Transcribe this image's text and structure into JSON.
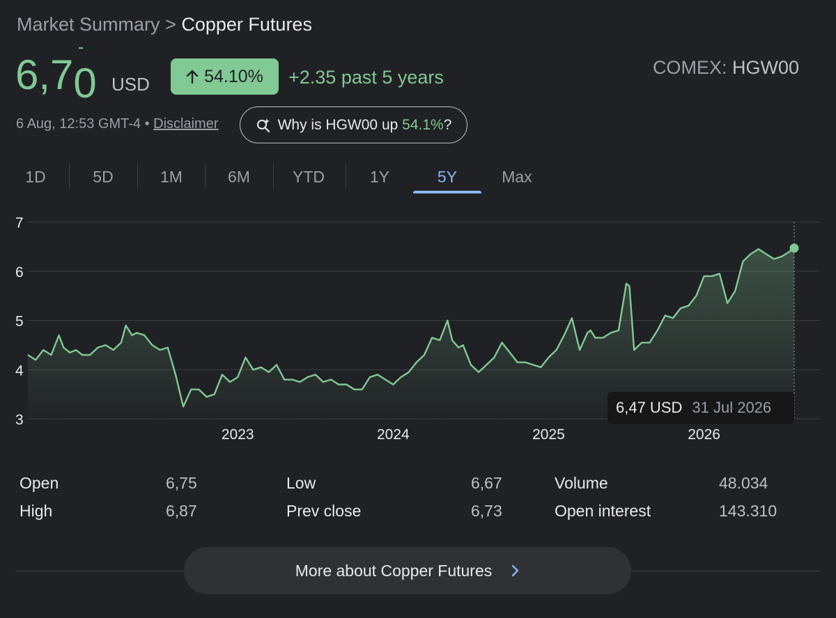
{
  "breadcrumb": {
    "parent": "Market Summary",
    "separator": ">",
    "current": "Copper Futures"
  },
  "price": {
    "main": "6,7",
    "last_digit": "0",
    "currency": "USD"
  },
  "change": {
    "percent": "54.10%",
    "text": "+2.35 past 5 years",
    "direction": "up"
  },
  "exchange": {
    "name": "COMEX:",
    "ticker": "HGW00"
  },
  "meta": {
    "timestamp": "6 Aug, 12:53 GMT-4",
    "bullet": "•",
    "disclaimer": "Disclaimer"
  },
  "why_button": {
    "prefix": "Why is HGW00 up",
    "percent": "54.1%",
    "suffix": "?"
  },
  "tabs": [
    {
      "label": "1D"
    },
    {
      "label": "5D"
    },
    {
      "label": "1M"
    },
    {
      "label": "6M"
    },
    {
      "label": "YTD"
    },
    {
      "label": "1Y"
    },
    {
      "label": "5Y",
      "active": true
    },
    {
      "label": "Max"
    }
  ],
  "tooltip": {
    "value": "6,47 USD",
    "date": "31 Jul 2026"
  },
  "stats": {
    "open_label": "Open",
    "open": "6,75",
    "high_label": "High",
    "high": "6,87",
    "low_label": "Low",
    "low": "6,67",
    "prev_close_label": "Prev close",
    "prev_close": "6,73",
    "volume_label": "Volume",
    "volume": "48.034",
    "open_interest_label": "Open interest",
    "open_interest": "143.310"
  },
  "more_button": {
    "label": "More about Copper Futures"
  },
  "colors": {
    "line": "#81c995",
    "accent": "#8ab4f8",
    "background": "#202124"
  },
  "chart_data": {
    "type": "area",
    "title": "",
    "xlabel": "",
    "ylabel": "",
    "ylim": [
      3,
      7
    ],
    "yticks": [
      "3",
      "4",
      "5",
      "6",
      "7"
    ],
    "xlim": [
      2021.65,
      2026.58
    ],
    "xticks": [
      {
        "label": "2023",
        "x": 2023.0
      },
      {
        "label": "2024",
        "x": 2024.0
      },
      {
        "label": "2025",
        "x": 2025.0
      },
      {
        "label": "2026",
        "x": 2026.0
      }
    ],
    "grid": true,
    "series": [
      {
        "x": [
          2021.65,
          2021.7,
          2021.75,
          2021.8,
          2021.85,
          2021.88,
          2021.92,
          2021.96,
          2022.0,
          2022.05,
          2022.1,
          2022.15,
          2022.2,
          2022.25,
          2022.28,
          2022.32,
          2022.35,
          2022.4,
          2022.45,
          2022.5,
          2022.55,
          2022.6,
          2022.65,
          2022.7,
          2022.75,
          2022.8,
          2022.85,
          2022.9,
          2022.95,
          2023.0,
          2023.05,
          2023.1,
          2023.15,
          2023.2,
          2023.25,
          2023.3,
          2023.35,
          2023.4,
          2023.45,
          2023.5,
          2023.55,
          2023.6,
          2023.65,
          2023.7,
          2023.75,
          2023.8,
          2023.85,
          2023.9,
          2023.95,
          2024.0,
          2024.05,
          2024.1,
          2024.15,
          2024.2,
          2024.25,
          2024.3,
          2024.35,
          2024.38,
          2024.42,
          2024.45,
          2024.5,
          2024.55,
          2024.6,
          2024.65,
          2024.7,
          2024.75,
          2024.8,
          2024.85,
          2024.9,
          2024.95,
          2025.0,
          2025.05,
          2025.1,
          2025.15,
          2025.2,
          2025.25,
          2025.27,
          2025.3,
          2025.35,
          2025.4,
          2025.45,
          2025.5,
          2025.52,
          2025.55,
          2025.6,
          2025.65,
          2025.7,
          2025.75,
          2025.8,
          2025.85,
          2025.9,
          2025.95,
          2026.0,
          2026.05,
          2026.1,
          2026.15,
          2026.2,
          2026.25,
          2026.3,
          2026.35,
          2026.4,
          2026.45,
          2026.5,
          2026.55,
          2026.58
        ],
        "y": [
          4.3,
          4.2,
          4.4,
          4.3,
          4.7,
          4.45,
          4.35,
          4.4,
          4.3,
          4.3,
          4.45,
          4.5,
          4.4,
          4.55,
          4.9,
          4.7,
          4.75,
          4.7,
          4.5,
          4.4,
          4.45,
          3.9,
          3.25,
          3.6,
          3.6,
          3.45,
          3.5,
          3.9,
          3.75,
          3.85,
          4.25,
          4.0,
          4.05,
          3.95,
          4.1,
          3.8,
          3.8,
          3.75,
          3.85,
          3.9,
          3.75,
          3.8,
          3.7,
          3.7,
          3.6,
          3.6,
          3.85,
          3.9,
          3.8,
          3.7,
          3.85,
          3.95,
          4.15,
          4.3,
          4.65,
          4.6,
          5.0,
          4.6,
          4.45,
          4.5,
          4.1,
          3.95,
          4.1,
          4.25,
          4.55,
          4.35,
          4.15,
          4.15,
          4.1,
          4.05,
          4.25,
          4.4,
          4.7,
          5.05,
          4.4,
          4.75,
          4.8,
          4.65,
          4.65,
          4.75,
          4.8,
          5.75,
          5.7,
          4.4,
          4.55,
          4.55,
          4.8,
          5.1,
          5.05,
          5.25,
          5.3,
          5.5,
          5.9,
          5.9,
          5.95,
          5.35,
          5.6,
          6.2,
          6.35,
          6.45,
          6.35,
          6.25,
          6.3,
          6.4,
          6.47
        ]
      }
    ]
  }
}
